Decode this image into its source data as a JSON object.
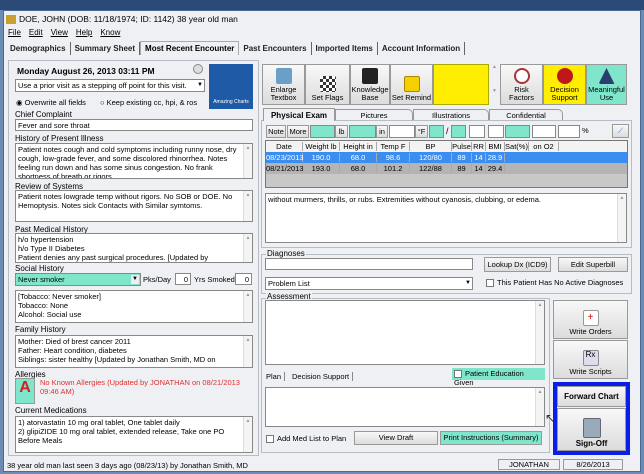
{
  "window": {
    "title": "DOE, JOHN (DOB: 11/18/1974; ID: 1142) 38 year old man"
  },
  "menu": [
    "File",
    "Edit",
    "View",
    "Help",
    "Know"
  ],
  "tabs": [
    "Demographics",
    "Summary Sheet",
    "Most Recent Encounter",
    "Past Encounters",
    "Imported Items",
    "Account Information"
  ],
  "left": {
    "date": "Monday August 26, 2013  03:11 PM",
    "prior_visit": "Use a prior visit as a stepping off point for this visit.",
    "radio_overwrite": "Overwrite all fields",
    "radio_keep": "Keep existing cc, hpi, & ros",
    "logo": "Amazing Charts",
    "chief_complaint_label": "Chief Complaint",
    "chief_complaint": "Fever and sore throat",
    "hpi_label": "History of Present Illness",
    "hpi": "Patient notes cough and cold symptoms including runny nose, dry cough, low-grade fever, and some discolored rhinorrhea. Notes feeling run down and has some sinus congestion. No frank shortness of breath or rigors.",
    "ros_label": "Review of Systems",
    "ros": "Patient notes lowgrade temp without rigors. No SOB or DOE. No Hemoptysis. Notes sick Contacts with Similar symtoms.",
    "pmh_label": "Past Medical History",
    "pmh": [
      "h/o hypertension",
      "h/o Type II Diabetes",
      "Patient denies any past surgical procedures. [Updated by Jonathan"
    ],
    "social_label": "Social History",
    "smoker": "Never smoker",
    "pks_label": "Pks/Day",
    "pks": "0",
    "yrs_label": "Yrs Smoked",
    "yrs": "0",
    "social": [
      "[Tobacco: Never smoker]",
      "Tobacco: None",
      "Alcohol: Social use"
    ],
    "family_label": "Family History",
    "family": [
      "Mother: Died of brest cancer 2011",
      "Father: Heart condition, diabetes",
      "Siblings: sister healthy [Updated by Jonathan Smith, MD on"
    ],
    "allergies_label": "Allergies",
    "allergies": "No Known Allergies (Updated by JONATHAN on 08/21/2013 09:46 AM)",
    "meds_label": "Current Medications",
    "meds": [
      "1) atorvastatin 10 mg oral tablet, One tablet daily",
      "2) glipiZIDE 10 mg oral tablet, extended release, Take one PO Before Meals"
    ]
  },
  "toolbar": {
    "enlarge": "Enlarge Textbox",
    "flags": "Set Flags",
    "knowledge": "Knowledge Base",
    "remind": "Set Remind",
    "risk": "Risk Factors",
    "decision": "Decision Support",
    "meaningful": "Meaningful Use"
  },
  "exam_tabs": [
    "Physical Exam",
    "Pictures",
    "Illustrations",
    "Confidential"
  ],
  "vitals_inputs": {
    "note": "Note",
    "more": "More",
    "lb": "lb",
    "in": "in",
    "f": "°F",
    "slash": "/",
    "pct": "%"
  },
  "vitals_table": {
    "headers": [
      "Date",
      "Weight lb",
      "Height in",
      "Temp F",
      "BP",
      "Pulse",
      "RR",
      "BMI",
      "Sat(%)",
      "on O2"
    ],
    "rows": [
      [
        "08/23/2013",
        "190.0",
        "68.0",
        "98.6",
        "120/80",
        "89",
        "14",
        "28.9",
        "",
        ""
      ],
      [
        "08/21/2013",
        "193.0",
        "68.0",
        "101.2",
        "122/88",
        "89",
        "14",
        "29.4",
        "",
        ""
      ]
    ]
  },
  "exam_text": "without murmers, thrills, or rubs. Extremities without cyanosis, clubbing, or edema.",
  "diagnoses": {
    "label": "Diagnoses",
    "lookup": "Lookup Dx (ICD9)",
    "superbill": "Edit Superbill",
    "problem_list": "Problem List",
    "no_active": "This Patient Has No Active Diagnoses"
  },
  "assessment_label": "Assessment",
  "write_orders": "Write Orders",
  "write_scripts": "Write Scripts",
  "plan_tabs": [
    "Plan",
    "Decision Support"
  ],
  "patient_education": "Patient Education Given",
  "add_med_list": "Add Med List to Plan",
  "view_draft": "View Draft",
  "print_instructions": "Print Instructions (Summary)",
  "forward_chart": "Forward Chart",
  "sign_off": "Sign-Off",
  "status": {
    "text": "38 year old man last seen 3 days ago (08/23/13) by Jonathan Smith, MD",
    "user": "JONATHAN",
    "date": "8/26/2013"
  }
}
